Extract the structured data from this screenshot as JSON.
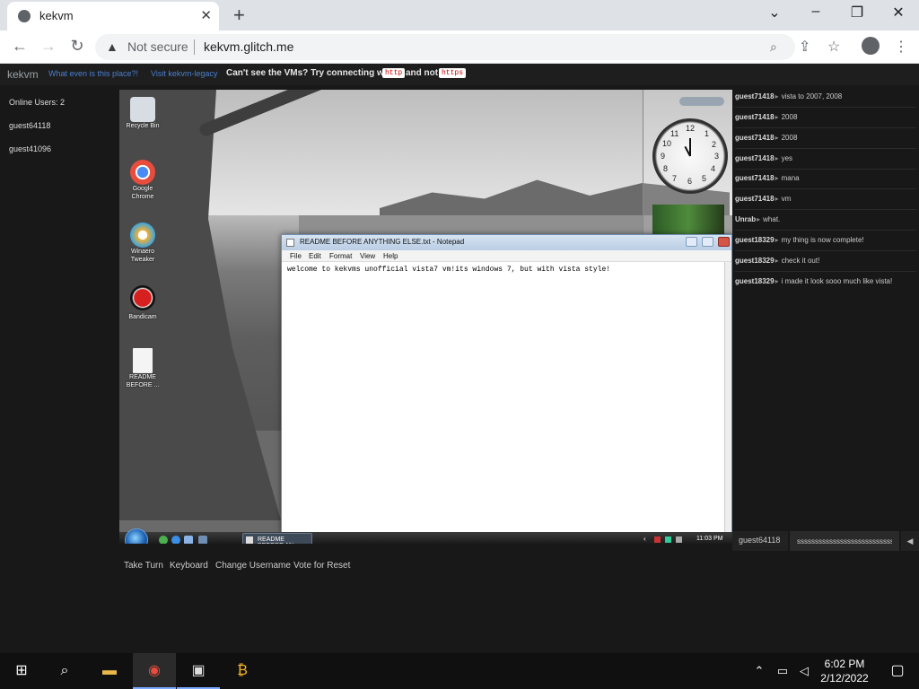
{
  "browser": {
    "tab_title": "kekvm",
    "security_label": "Not secure",
    "url": "kekvm.glitch.me"
  },
  "page": {
    "brand": "kekvm",
    "links": [
      "What even is this place?!",
      "Visit kekvm-legacy"
    ],
    "notice": "Can't see the VMs? Try connecting with",
    "notice_and_not": "and not",
    "code_http": "http",
    "code_https": "https",
    "online_users_label": "Online Users: 2",
    "users": [
      "guest64118",
      "guest41096"
    ]
  },
  "vm": {
    "desktop_icons": [
      {
        "label": "Recycle Bin",
        "icon": "recycle-bin-icon",
        "color": "#d8dde3"
      },
      {
        "label": "Google Chrome",
        "icon": "chrome-icon",
        "color": "#e74c3c"
      },
      {
        "label": "Winaero Tweaker",
        "icon": "winaero-icon",
        "color": "#f2b134"
      },
      {
        "label": "Bandicam",
        "icon": "bandicam-icon",
        "color": "#d61f1f"
      },
      {
        "label": "README BEFORE ...",
        "icon": "text-file-icon",
        "color": "#f4f4f4"
      }
    ],
    "notepad": {
      "title": "README BEFORE ANYTHING ELSE.txt - Notepad",
      "menu": [
        "File",
        "Edit",
        "Format",
        "View",
        "Help"
      ],
      "content": "welcome to kekvms unofficial vista7 vm!its windows 7, but with vista style!"
    },
    "taskbar": {
      "item_label": "README BEFORE AN...",
      "time": "11:03 PM"
    },
    "clock_numbers": [
      "12",
      "1",
      "2",
      "3",
      "4",
      "5",
      "6",
      "7",
      "8",
      "9",
      "10",
      "11"
    ]
  },
  "chat": {
    "messages": [
      {
        "user": "guest71418",
        "text": "vista to 2007, 2008"
      },
      {
        "user": "guest71418",
        "text": "2008"
      },
      {
        "user": "guest71418",
        "text": "2008"
      },
      {
        "user": "guest71418",
        "text": "yes"
      },
      {
        "user": "guest71418",
        "text": "mana"
      },
      {
        "user": "guest71418",
        "text": "vm"
      },
      {
        "user": "Unrab",
        "text": "what."
      },
      {
        "user": "guest18329",
        "text": "my thing is now complete!"
      },
      {
        "user": "guest18329",
        "text": "check it out!"
      },
      {
        "user": "guest18329",
        "text": "i made it look sooo much like vista!"
      }
    ],
    "current_user": "guest64118",
    "input_value": "sssssssssssssssssssssssssss"
  },
  "vm_buttons": [
    "Take Turn",
    "Keyboard",
    "Change Username",
    "Vote for Reset"
  ],
  "windows_taskbar": {
    "time": "6:02 PM",
    "date": "2/12/2022"
  }
}
